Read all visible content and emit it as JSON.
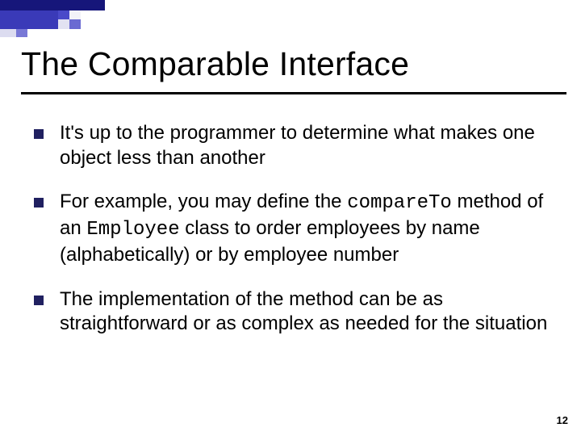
{
  "title": "The Comparable Interface",
  "bullets": [
    {
      "text_a": "It's up to the programmer to determine what makes one object less than another"
    },
    {
      "text_a": "For example, you may define the ",
      "code_a": "compareTo",
      "text_b": " method of an ",
      "code_b": "Employee",
      "text_c": " class to order employees by name (alphabetically) or by employee number"
    },
    {
      "text_a": "The implementation of the method can be as straightforward or as complex as needed for the situation"
    }
  ],
  "page_number": "12"
}
